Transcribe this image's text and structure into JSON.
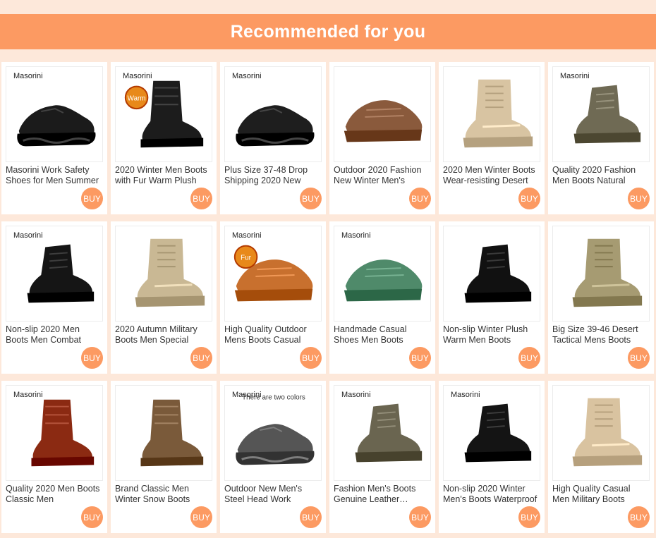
{
  "header": {
    "title": "Recommended for you"
  },
  "products": [
    {
      "brand": "Masorini",
      "title": "Masorini Work Safety Shoes for Men Summer",
      "buy": "BUY",
      "style": "sneaker",
      "color": "#1b1b1b",
      "badge": ""
    },
    {
      "brand": "Masorini",
      "title": "2020 Winter Men Boots with Fur Warm Plush",
      "buy": "BUY",
      "style": "tall",
      "color": "#1c1c1c",
      "badge": "Warm"
    },
    {
      "brand": "Masorini",
      "title": "Plus Size 37-48 Drop Shipping 2020 New",
      "buy": "BUY",
      "style": "sneaker",
      "color": "#1e1e1e",
      "badge": ""
    },
    {
      "brand": "",
      "title": "Outdoor 2020 Fashion New Winter Men's",
      "buy": "BUY",
      "style": "casual",
      "color": "#8a5a3c",
      "badge": ""
    },
    {
      "brand": "",
      "title": "2020 Men Winter Boots Wear-resisting Desert",
      "buy": "BUY",
      "style": "high",
      "color": "#d8c4a2",
      "badge": ""
    },
    {
      "brand": "Masorini",
      "title": "Quality 2020 Fashion Men Boots Natural",
      "buy": "BUY",
      "style": "ankle",
      "color": "#6f6a54",
      "badge": ""
    },
    {
      "brand": "Masorini",
      "title": "Non-slip 2020 Men Boots Men Combat",
      "buy": "BUY",
      "style": "ankle",
      "color": "#151515",
      "badge": ""
    },
    {
      "brand": "",
      "title": "2020 Autumn Military Boots Men Special",
      "buy": "BUY",
      "style": "high",
      "color": "#c9b894",
      "badge": ""
    },
    {
      "brand": "Masorini",
      "title": "High Quality Outdoor Mens Boots Casual",
      "buy": "BUY",
      "style": "casual",
      "color": "#c8702e",
      "badge": "Fur"
    },
    {
      "brand": "Masorini",
      "title": "Handmade Casual Shoes Men Boots",
      "buy": "BUY",
      "style": "casual",
      "color": "#4f8a6a",
      "badge": ""
    },
    {
      "brand": "",
      "title": "Non-slip Winter Plush Warm Men Boots",
      "buy": "BUY",
      "style": "ankle",
      "color": "#111111",
      "badge": ""
    },
    {
      "brand": "",
      "title": "Big Size 39-46 Desert Tactical Mens Boots",
      "buy": "BUY",
      "style": "high",
      "color": "#a69b72",
      "badge": ""
    },
    {
      "brand": "Masorini",
      "title": "Quality 2020 Men Boots Classic Men",
      "buy": "BUY",
      "style": "tall",
      "color": "#8b2a12",
      "badge": ""
    },
    {
      "brand": "",
      "title": "Brand Classic Men Winter Snow Boots",
      "buy": "BUY",
      "style": "tall",
      "color": "#7a5a3a",
      "badge": ""
    },
    {
      "brand": "Masorini",
      "title": "Outdoor New Men's Steel Head Work",
      "buy": "BUY",
      "style": "sneaker",
      "color": "#555555",
      "badge": "There are two colors"
    },
    {
      "brand": "Masorini",
      "title": "Fashion Men's Boots Genuine Leather Casual",
      "buy": "BUY",
      "style": "ankle",
      "color": "#6a6550",
      "badge": ""
    },
    {
      "brand": "Masorini",
      "title": "Non-slip 2020 Winter Men's Boots Waterproof",
      "buy": "BUY",
      "style": "ankle",
      "color": "#141414",
      "badge": ""
    },
    {
      "brand": "",
      "title": "High Quality Casual Men Military Boots",
      "buy": "BUY",
      "style": "high",
      "color": "#d9c3a0",
      "badge": ""
    }
  ]
}
